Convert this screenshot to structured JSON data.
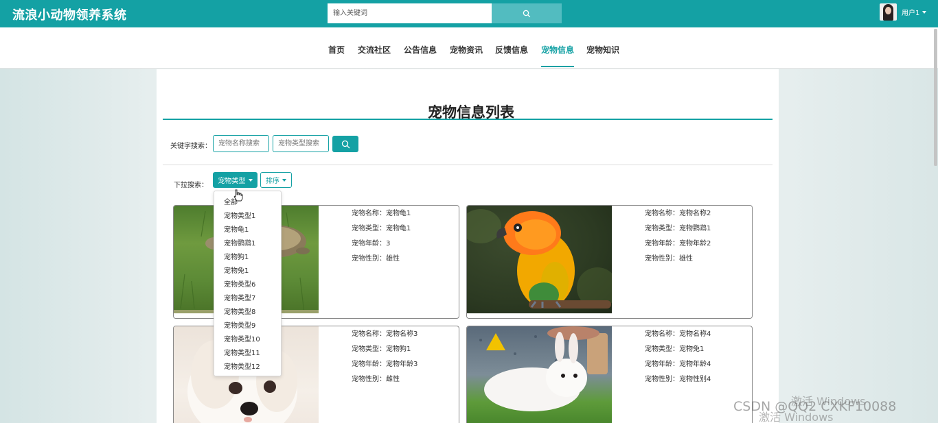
{
  "app": {
    "title": "流浪小动物领养系统"
  },
  "search": {
    "placeholder": "输入关键词"
  },
  "user": {
    "name": "用户1"
  },
  "nav": {
    "items": [
      {
        "label": "首页",
        "active": false
      },
      {
        "label": "交流社区",
        "active": false
      },
      {
        "label": "公告信息",
        "active": false
      },
      {
        "label": "宠物资讯",
        "active": false
      },
      {
        "label": "反馈信息",
        "active": false
      },
      {
        "label": "宠物信息",
        "active": true
      },
      {
        "label": "宠物知识",
        "active": false
      }
    ]
  },
  "page": {
    "title": "宠物信息列表"
  },
  "filters": {
    "keyword_label": "关键字搜索：",
    "name_placeholder": "宠物名称搜索",
    "type_placeholder": "宠物类型搜索",
    "dropdown_label": "下拉搜索：",
    "type_button": "宠物类型",
    "sort_button": "排序"
  },
  "dropdown": {
    "open": true,
    "options": [
      "全部",
      "宠物类型1",
      "宠物龟1",
      "宠物鹦鹉1",
      "宠物狗1",
      "宠物兔1",
      "宠物类型6",
      "宠物类型7",
      "宠物类型8",
      "宠物类型9",
      "宠物类型10",
      "宠物类型11",
      "宠物类型12"
    ]
  },
  "cards": [
    {
      "image": "turtle-photo",
      "lines": [
        "宠物名称：宠物龟1",
        "宠物类型：宠物龟1",
        "宠物年龄：3",
        "宠物性别：雄性"
      ]
    },
    {
      "image": "parrot-photo",
      "lines": [
        "宠物名称：宠物名称2",
        "宠物类型：宠物鹦鹉1",
        "宠物年龄：宠物年龄2",
        "宠物性别：雄性"
      ]
    },
    {
      "image": "dog-photo",
      "lines": [
        "宠物名称：宠物名称3",
        "宠物类型：宠物狗1",
        "宠物年龄：宠物年龄3",
        "宠物性别：雌性"
      ]
    },
    {
      "image": "rabbit-photo",
      "lines": [
        "宠物名称：宠物名称4",
        "宠物类型：宠物兔1",
        "宠物年龄：宠物年龄4",
        "宠物性别：宠物性别4"
      ]
    }
  ],
  "overlays": {
    "activate_line1": "激活 Windows",
    "activate_line2": "激活 Windows",
    "csdn": "CSDN @QQ2 CXKF10088"
  },
  "colors": {
    "primary": "#14a1a4",
    "search_button": "#52bcc0"
  }
}
